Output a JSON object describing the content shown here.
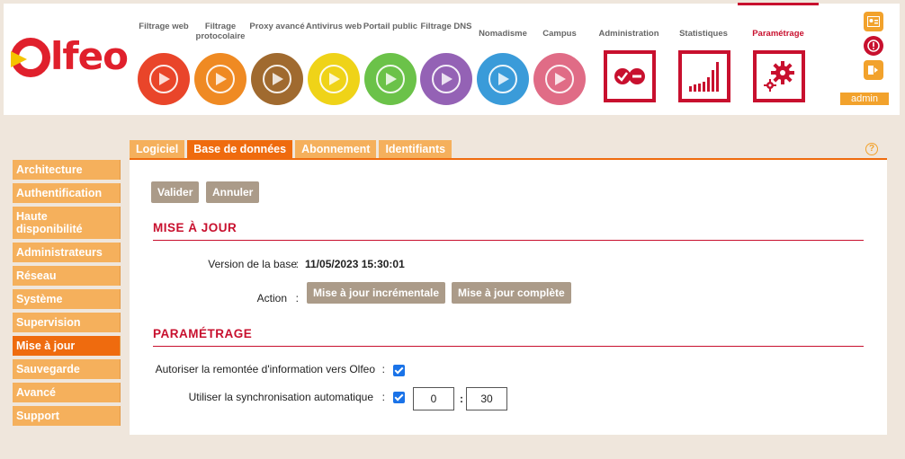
{
  "brand": {
    "logo_text": "lfeo"
  },
  "modules": [
    {
      "label": "Filtrage web",
      "color": "#e9452a"
    },
    {
      "label": "Filtrage protocolaire",
      "color": "#ef8a23"
    },
    {
      "label": "Proxy avancé",
      "color": "#a06a2f"
    },
    {
      "label": "Antivirus web",
      "color": "#efd318"
    },
    {
      "label": "Portail public",
      "color": "#6bc249"
    },
    {
      "label": "Filtrage DNS",
      "color": "#9462b5"
    },
    {
      "label": "Nomadisme",
      "color": "#3a9bd9"
    },
    {
      "label": "Campus",
      "color": "#e06c86"
    }
  ],
  "admin_modules": [
    {
      "label": "Administration"
    },
    {
      "label": "Statistiques"
    },
    {
      "label": "Paramétrage"
    }
  ],
  "user": {
    "name": "admin"
  },
  "sidebar": {
    "items": [
      {
        "label": "Architecture"
      },
      {
        "label": "Authentification"
      },
      {
        "label": "Haute disponibilité"
      },
      {
        "label": "Administrateurs"
      },
      {
        "label": "Réseau"
      },
      {
        "label": "Système"
      },
      {
        "label": "Supervision"
      },
      {
        "label": "Mise à jour"
      },
      {
        "label": "Sauvegarde"
      },
      {
        "label": "Avancé"
      },
      {
        "label": "Support"
      }
    ],
    "active_index": 7
  },
  "tabs": [
    {
      "label": "Logiciel"
    },
    {
      "label": "Base de données"
    },
    {
      "label": "Abonnement"
    },
    {
      "label": "Identifiants"
    }
  ],
  "active_tab": 1,
  "help": {
    "label": "?"
  },
  "actions": {
    "validate": "Valider",
    "cancel": "Annuler"
  },
  "update_section": {
    "title": "MISE À JOUR",
    "version_label": "Version de la base",
    "version_value": "11/05/2023 15:30:01",
    "action_label": "Action",
    "incremental_button": "Mise à jour incrémentale",
    "full_button": "Mise à jour complète"
  },
  "settings_section": {
    "title": "PARAMÉTRAGE",
    "feedback_label": "Autoriser la remontée d'information vers Olfeo",
    "feedback_checked": true,
    "autosync_label": "Utiliser la synchronisation automatique",
    "autosync_checked": true,
    "hour_value": "0",
    "minute_value": "30",
    "time_separator": ":"
  },
  "colon": ":",
  "colors": {
    "accent": "#ef6b0e",
    "tab": "#f5b05c",
    "brand_red": "#c8102e",
    "button": "#ab9b89"
  }
}
